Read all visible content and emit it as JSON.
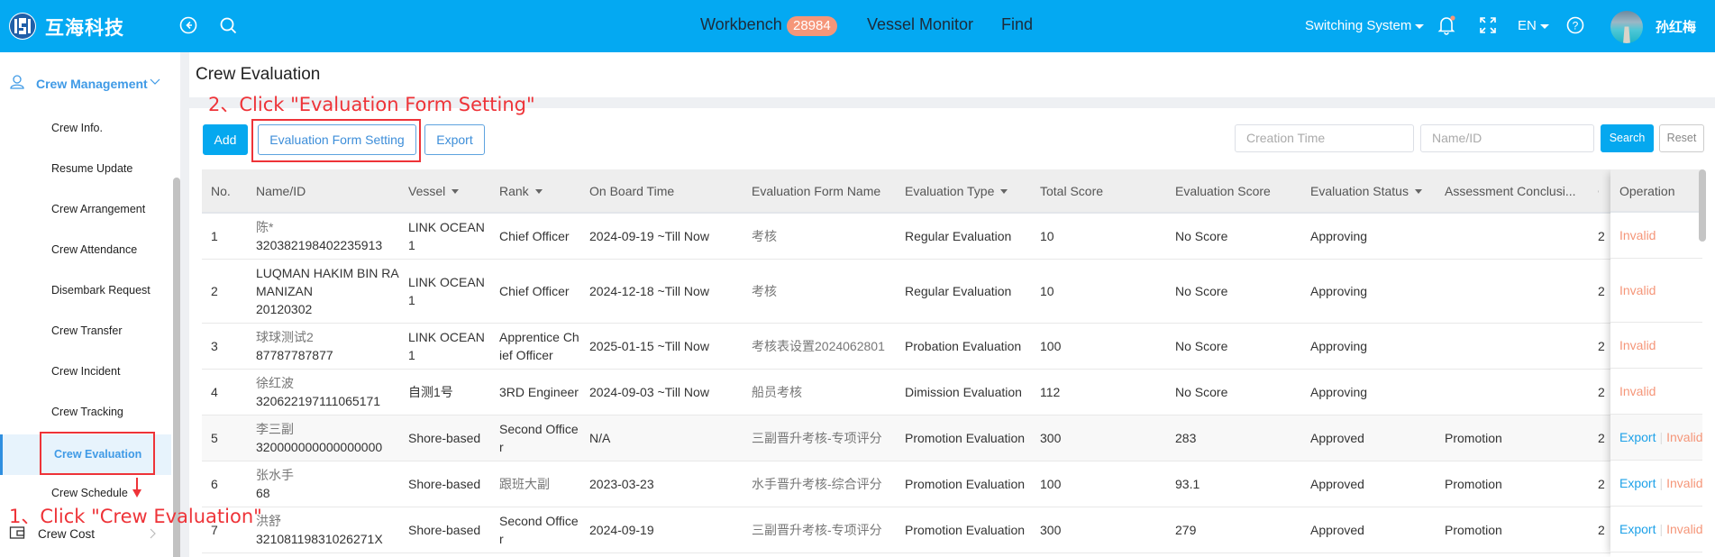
{
  "header": {
    "brand": "互海科技",
    "nav": [
      {
        "label": "Workbench",
        "badge": "28984"
      },
      {
        "label": "Vessel Monitor"
      },
      {
        "label": "Find"
      }
    ],
    "switch_system": "Switching System",
    "language": "EN",
    "username": "孙红梅",
    "colors": {
      "bar": "#04a9f2",
      "badge": "#f59679"
    }
  },
  "sidebar": {
    "group": "Crew Management",
    "items": [
      {
        "label": "Crew Info."
      },
      {
        "label": "Resume Update"
      },
      {
        "label": "Crew Arrangement"
      },
      {
        "label": "Crew Attendance"
      },
      {
        "label": "Disembark Request"
      },
      {
        "label": "Crew Transfer"
      },
      {
        "label": "Crew Incident"
      },
      {
        "label": "Crew Tracking"
      },
      {
        "label": "Crew Evaluation",
        "active": true
      },
      {
        "label": "Crew Schedule"
      }
    ],
    "next_group": "Crew Cost"
  },
  "page": {
    "title": "Crew Evaluation",
    "toolbar": {
      "add": "Add",
      "form_setting": "Evaluation Form Setting",
      "export": "Export"
    },
    "filters": {
      "creation_time_placeholder": "Creation Time",
      "name_id_placeholder": "Name/ID",
      "search": "Search",
      "reset": "Reset"
    }
  },
  "table": {
    "columns": [
      "No.",
      "Name/ID",
      "Vessel",
      "Rank",
      "On Board Time",
      "Evaluation Form Name",
      "Evaluation Type",
      "Total Score",
      "Evaluation Score",
      "Evaluation Status",
      "Assessment Conclusi...",
      "C",
      "Operation"
    ],
    "rows": [
      {
        "no": "1",
        "name": "陈*",
        "id": "320382198402235913",
        "vessel": "LINK OCEAN 1",
        "rank": "Chief Officer",
        "onboard": "2024-09-19 ~Till Now",
        "form": "考核",
        "type": "Regular Evaluation",
        "total": "10",
        "score": "No Score",
        "status": "Approving",
        "conclusion": "",
        "hidden": "2",
        "ops": [
          "Invalid"
        ]
      },
      {
        "no": "2",
        "name": "LUQMAN HAKIM BIN RAMANIZAN",
        "id": "20120302",
        "vessel": "LINK OCEAN 1",
        "rank": "Chief Officer",
        "onboard": "2024-12-18 ~Till Now",
        "form": "考核",
        "type": "Regular Evaluation",
        "total": "10",
        "score": "No Score",
        "status": "Approving",
        "conclusion": "",
        "hidden": "2",
        "ops": [
          "Invalid"
        ]
      },
      {
        "no": "3",
        "name": "球球测试2",
        "id": "87787787877",
        "vessel": "LINK OCEAN 1",
        "rank": "Apprentice Chief Officer",
        "onboard": "2025-01-15 ~Till Now",
        "form": "考核表设置2024062801",
        "type": "Probation Evaluation",
        "total": "100",
        "score": "No Score",
        "status": "Approving",
        "conclusion": "",
        "hidden": "2",
        "ops": [
          "Invalid"
        ]
      },
      {
        "no": "4",
        "name": "徐红波",
        "id": "320622197111065171",
        "vessel": "自测1号",
        "rank": "3RD Engineer",
        "onboard": "2024-09-03 ~Till Now",
        "form": "船员考核",
        "type": "Dimission Evaluation",
        "total": "112",
        "score": "No Score",
        "status": "Approving",
        "conclusion": "",
        "hidden": "2",
        "ops": [
          "Invalid"
        ]
      },
      {
        "no": "5",
        "name": "李三副",
        "id": "320000000000000000",
        "vessel": "Shore-based",
        "rank": "Second Officer",
        "onboard": "N/A",
        "form": "三副晋升考核-专项评分",
        "type": "Promotion Evaluation",
        "total": "300",
        "score": "283",
        "status": "Approved",
        "conclusion": "Promotion",
        "hidden": "2",
        "ops": [
          "Export",
          "Invalid"
        ]
      },
      {
        "no": "6",
        "name": "张水手",
        "id": "68",
        "vessel": "Shore-based",
        "rank": "跟班大副",
        "onboard": "2023-03-23",
        "form": "水手晋升考核-综合评分",
        "type": "Promotion Evaluation",
        "total": "100",
        "score": "93.1",
        "status": "Approved",
        "conclusion": "Promotion",
        "hidden": "2",
        "ops": [
          "Export",
          "Invalid"
        ]
      },
      {
        "no": "7",
        "name": "洪舒",
        "id": "32108119831026271X",
        "vessel": "Shore-based",
        "rank": "Second Officer",
        "onboard": "2024-09-19",
        "form": "三副晋升考核-专项评分",
        "type": "Promotion Evaluation",
        "total": "300",
        "score": "279",
        "status": "Approved",
        "conclusion": "Promotion",
        "hidden": "2",
        "ops": [
          "Export",
          "Invalid"
        ]
      }
    ]
  },
  "annotations": {
    "step1": "1、Click \"Crew Evaluation\"",
    "step2": "2、Click \"Evaluation Form Setting\"",
    "color": "#ee3338"
  }
}
